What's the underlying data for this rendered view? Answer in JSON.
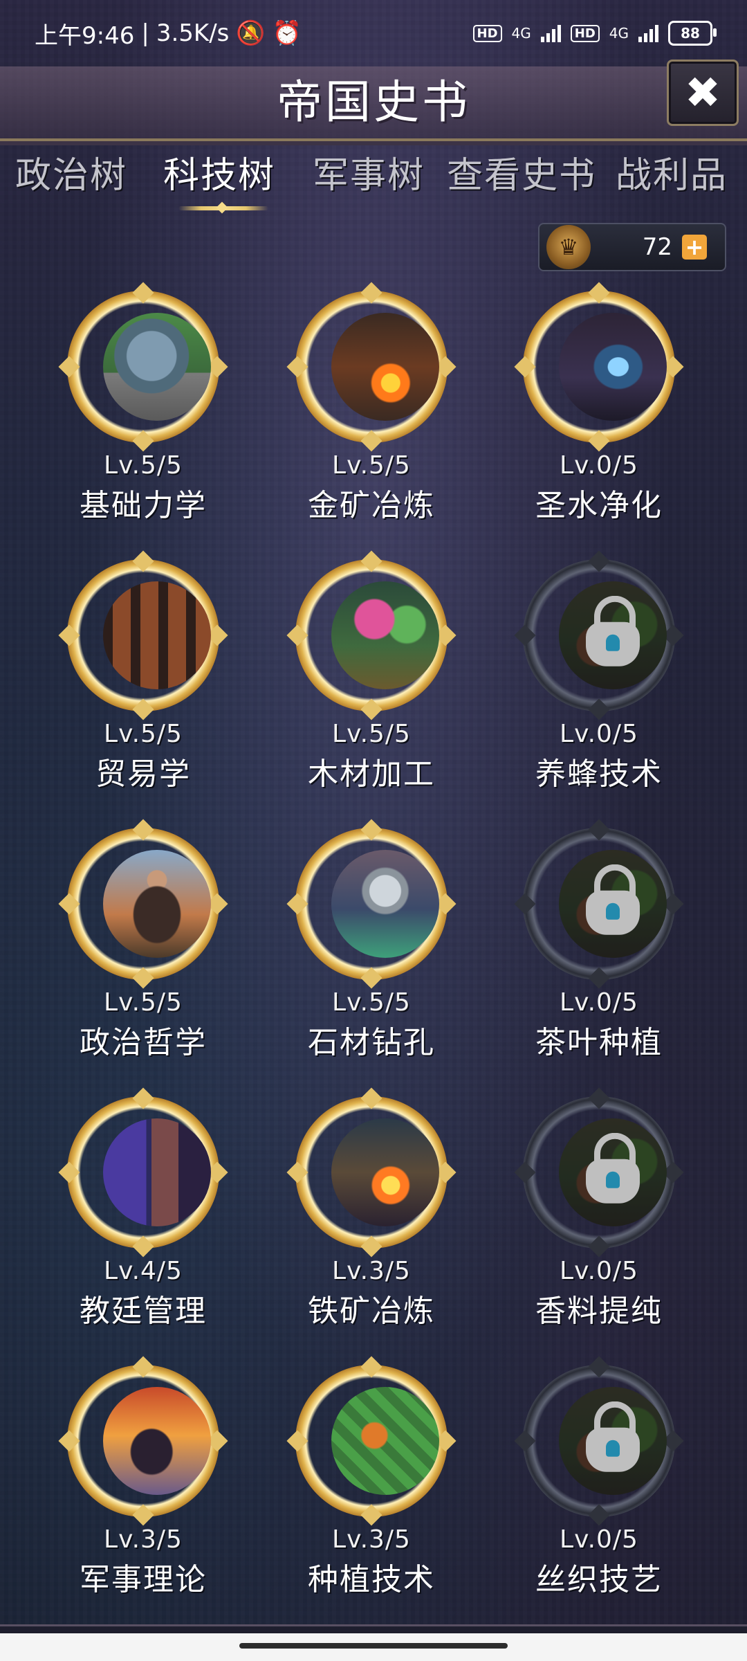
{
  "status_bar": {
    "time": "上午9:46",
    "speed": "3.5K/s",
    "battery": "88",
    "hd": "HD",
    "net": "4G"
  },
  "header": {
    "title": "帝国史书"
  },
  "tabs": [
    {
      "label": "政治树"
    },
    {
      "label": "科技树"
    },
    {
      "label": "军事树"
    },
    {
      "label": "查看史书"
    },
    {
      "label": "战利品"
    }
  ],
  "currency": {
    "amount": "72",
    "plus": "+"
  },
  "techs": [
    {
      "name": "基础力学",
      "level": "Lv.5/5",
      "locked": false,
      "art": "statue"
    },
    {
      "name": "金矿冶炼",
      "level": "Lv.5/5",
      "locked": false,
      "art": "forge"
    },
    {
      "name": "圣水净化",
      "level": "Lv.0/5",
      "locked": false,
      "art": "shrine"
    },
    {
      "name": "贸易学",
      "level": "Lv.5/5",
      "locked": false,
      "art": "market"
    },
    {
      "name": "木材加工",
      "level": "Lv.5/5",
      "locked": false,
      "art": "forest"
    },
    {
      "name": "养蜂技术",
      "level": "Lv.0/5",
      "locked": true,
      "art": "lock"
    },
    {
      "name": "政治哲学",
      "level": "Lv.5/5",
      "locked": false,
      "art": "scholar"
    },
    {
      "name": "石材钻孔",
      "level": "Lv.5/5",
      "locked": false,
      "art": "drill"
    },
    {
      "name": "茶叶种植",
      "level": "Lv.0/5",
      "locked": true,
      "art": "lock"
    },
    {
      "name": "教廷管理",
      "level": "Lv.4/5",
      "locked": false,
      "art": "church"
    },
    {
      "name": "铁矿冶炼",
      "level": "Lv.3/5",
      "locked": false,
      "art": "furnace"
    },
    {
      "name": "香料提纯",
      "level": "Lv.0/5",
      "locked": true,
      "art": "lock"
    },
    {
      "name": "军事理论",
      "level": "Lv.3/5",
      "locked": false,
      "art": "knight"
    },
    {
      "name": "种植技术",
      "level": "Lv.3/5",
      "locked": false,
      "art": "farm"
    },
    {
      "name": "丝织技艺",
      "level": "Lv.0/5",
      "locked": true,
      "art": "lock"
    }
  ]
}
